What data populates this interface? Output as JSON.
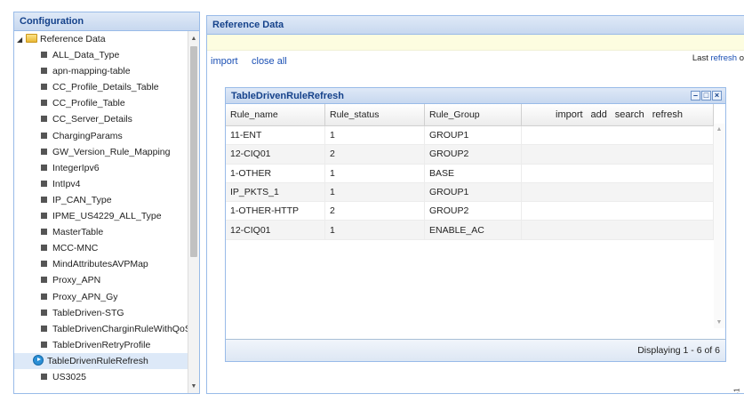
{
  "left_panel": {
    "title": "Configuration",
    "root_label": "Reference Data",
    "items": [
      "ALL_Data_Type",
      "apn-mapping-table",
      "CC_Profile_Details_Table",
      "CC_Profile_Table",
      "CC_Server_Details",
      "ChargingParams",
      "GW_Version_Rule_Mapping",
      "IntegerIpv6",
      "IntIpv4",
      "IP_CAN_Type",
      "IPME_US4229_ALL_Type",
      "MasterTable",
      "MCC-MNC",
      "MindAttributesAVPMap",
      "Proxy_APN",
      "Proxy_APN_Gy",
      "TableDriven-STG",
      "TableDrivenCharginRuleWithQoS",
      "TableDrivenRetryProfile"
    ],
    "selected_item": "TableDrivenRuleRefresh",
    "last_item": "US3025"
  },
  "right_panel": {
    "title": "Reference Data",
    "import_label": "import",
    "close_all_label": "close all",
    "last_refresh_prefix": "Last ",
    "last_refresh_link": "refresh",
    "last_refresh_suffix": " o"
  },
  "grid": {
    "title": "TableDrivenRuleRefresh",
    "columns": [
      "Rule_name",
      "Rule_status",
      "Rule_Group"
    ],
    "actions": [
      "import",
      "add",
      "search",
      "refresh"
    ],
    "rows": [
      [
        "11-ENT",
        "1",
        "GROUP1"
      ],
      [
        "12-CIQ01",
        "2",
        "GROUP2"
      ],
      [
        "1-OTHER",
        "1",
        "BASE"
      ],
      [
        "IP_PKTS_1",
        "1",
        "GROUP1"
      ],
      [
        "1-OTHER-HTTP",
        "2",
        "GROUP2"
      ],
      [
        "12-CIQ01",
        "1",
        "ENABLE_AC"
      ]
    ],
    "footer": "Displaying 1 - 6 of 6"
  },
  "side_id": "352551"
}
